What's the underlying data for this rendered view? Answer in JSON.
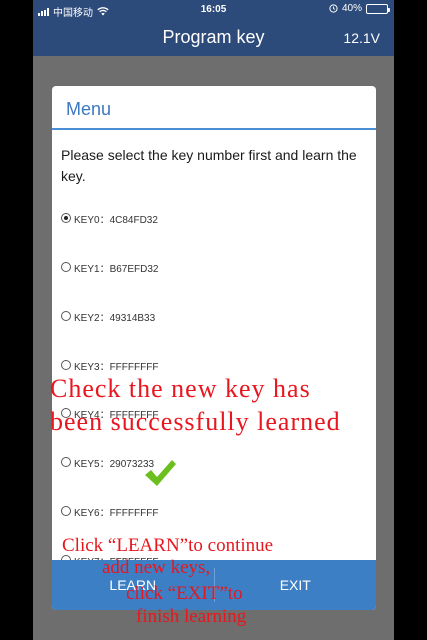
{
  "status_bar": {
    "carrier": "中国移动",
    "time": "16:05",
    "battery": "40%"
  },
  "title_bar": {
    "title": "Program key",
    "voltage": "12.1V"
  },
  "dialog": {
    "title": "Menu",
    "instruction": "Please select the key number first and learn the key.",
    "keys": [
      {
        "label": "KEY0：4C84FD32",
        "selected": true
      },
      {
        "label": "KEY1：B67EFD32",
        "selected": false
      },
      {
        "label": "KEY2：49314B33",
        "selected": false
      },
      {
        "label": "KEY3：FFFFFFFF",
        "selected": false
      },
      {
        "label": "KEY4：FFFFFFFF",
        "selected": false
      },
      {
        "label": "KEY5：29073233",
        "selected": false
      },
      {
        "label": "KEY6：FFFFFFFF",
        "selected": false
      },
      {
        "label": "KEY7：FFFFFFFF",
        "selected": false
      }
    ],
    "buttons": {
      "learn": "LEARN",
      "exit": "EXIT"
    }
  },
  "overlay": {
    "line1": "Check the new key has",
    "line2": "been successfully learned",
    "line3": "Click “LEARN”to continue",
    "line4": "add new keys,",
    "line5": "click “EXIT”to",
    "line6": "finish learning"
  },
  "colors": {
    "header_bg": "#2c4a7a",
    "accent": "#3b79c0",
    "button_bar": "#3d7fc5",
    "annotation": "#e8161e",
    "check": "#6bbf1f"
  }
}
